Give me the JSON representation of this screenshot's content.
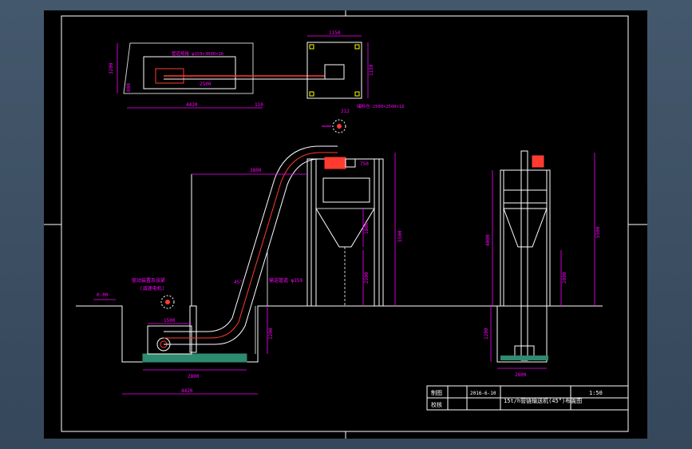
{
  "title_block": {
    "drawn_label": "制图",
    "check_label": "校核",
    "date": "2016-6-10",
    "drawing_name": "15t/h管链输送机(45°)布置图",
    "scale": "1:50"
  },
  "plan_view": {
    "dim_length": "4420",
    "dim_right": "110",
    "dim_height": "3200",
    "dim_left_small": "800",
    "dim_mid": "2500",
    "note_top": "管道规格 φ159×3000×16",
    "hopper_dim_top": "1150",
    "hopper_dim_side": "1150",
    "hopper_note": "储料仓 2500×2500×16",
    "hopper_dim_small": "212"
  },
  "elevation_view": {
    "ground_level": "0.00",
    "dim_top_span": "3800",
    "dim_outlet": "750",
    "dim_total_height": "5500",
    "dim_mid_height": "1800",
    "dim_lower_height": "2500",
    "dim_pit_depth": "1200",
    "dim_base_short": "1500",
    "dim_base_long": "2800",
    "dim_base_total": "4420",
    "angle": "45°",
    "note_drive": "驱动装置及张紧",
    "note_drive_sub": "(减速电机)",
    "note_pipe": "输送管道 φ159"
  },
  "side_view": {
    "dim_total_height": "5500",
    "dim_upper": "4000",
    "dim_mid": "2800",
    "dim_pit": "1200",
    "dim_base": "2600"
  },
  "colors": {
    "line_white": "#ffffff",
    "dim_magenta": "#ff00ff",
    "pipe_red": "#ff3b2f",
    "ground_green": "#2e8b6f",
    "structure_gray": "#c8c8c8"
  }
}
